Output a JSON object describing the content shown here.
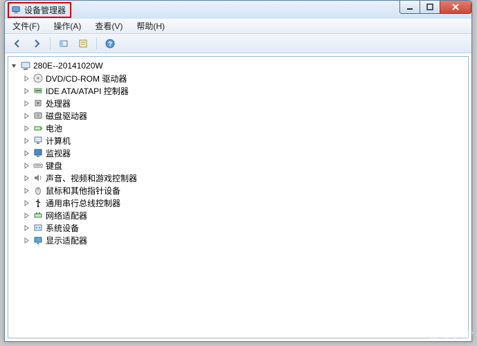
{
  "window": {
    "title": "设备管理器"
  },
  "menu": {
    "file": "文件(F)",
    "action": "操作(A)",
    "view": "查看(V)",
    "help": "帮助(H)"
  },
  "toolbar": {
    "back": "back",
    "forward": "forward",
    "pipe": "pipe",
    "refresh": "refresh",
    "help": "help"
  },
  "tree": {
    "root": {
      "label": "280E--20141020W",
      "expanded": true
    },
    "items": [
      {
        "label": "DVD/CD-ROM 驱动器",
        "icon": "disc-icon"
      },
      {
        "label": "IDE ATA/ATAPI 控制器",
        "icon": "ide-icon"
      },
      {
        "label": "处理器",
        "icon": "cpu-icon"
      },
      {
        "label": "磁盘驱动器",
        "icon": "hdd-icon"
      },
      {
        "label": "电池",
        "icon": "battery-icon"
      },
      {
        "label": "计算机",
        "icon": "computer-icon"
      },
      {
        "label": "监视器",
        "icon": "monitor-icon"
      },
      {
        "label": "键盘",
        "icon": "keyboard-icon"
      },
      {
        "label": "声音、视频和游戏控制器",
        "icon": "sound-icon"
      },
      {
        "label": "鼠标和其他指针设备",
        "icon": "mouse-icon"
      },
      {
        "label": "通用串行总线控制器",
        "icon": "usb-icon"
      },
      {
        "label": "网络适配器",
        "icon": "network-icon"
      },
      {
        "label": "系统设备",
        "icon": "system-icon"
      },
      {
        "label": "显示适配器",
        "icon": "display-icon"
      }
    ]
  },
  "watermark": "系统之家"
}
